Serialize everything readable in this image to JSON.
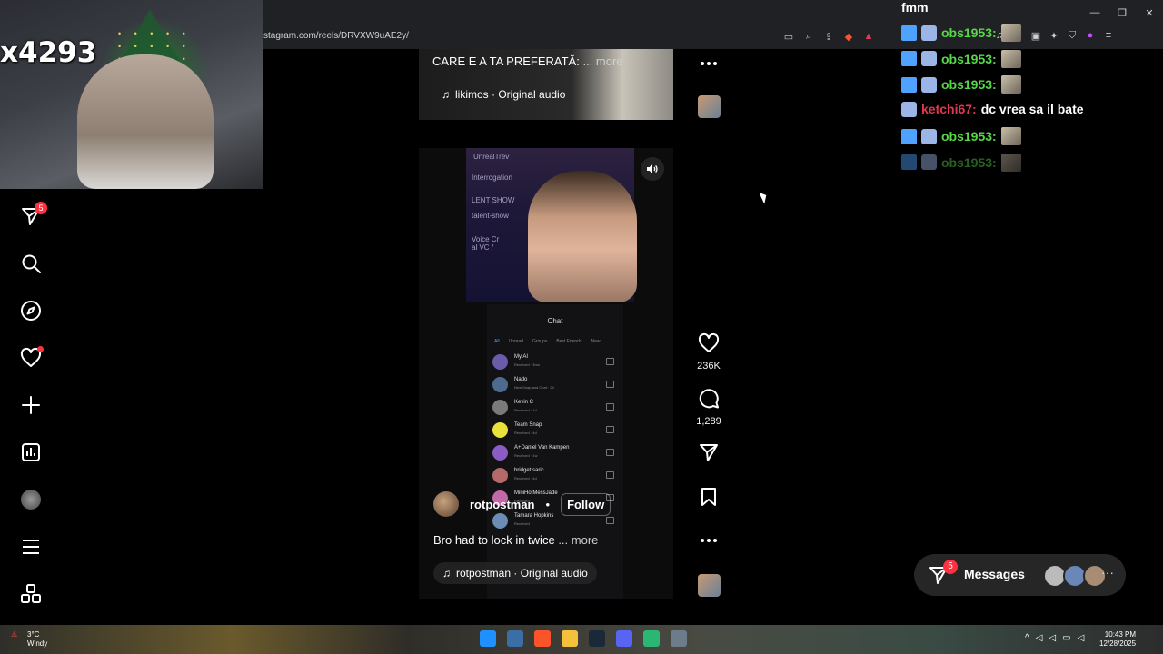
{
  "browser": {
    "url": "stagram.com/reels/DRVXW9uAE2y/"
  },
  "webcam": {
    "overlay_text": "x4293"
  },
  "nav": {
    "notifications_badge": "5"
  },
  "prev_reel": {
    "caption": "CARE E A TA PREFERATĂ:",
    "more": "... more",
    "audio": "likimos · Original audio"
  },
  "reel": {
    "stream_user": "UnrealTrev",
    "stream_lines": [
      "Interrogation",
      "LENT SHOW",
      "talent-show",
      "Voice Cr",
      "al VC /"
    ],
    "phone_header": "Chat",
    "phone_filters": [
      "All",
      "Unread",
      "Groups",
      "Best Friends",
      "New"
    ],
    "phone_chats": [
      {
        "name": "My AI",
        "sub": "Received · 3mo",
        "color": "#6b5cab"
      },
      {
        "name": "Nado",
        "sub": "New Snap and Chat · 2h",
        "color": "#4e6b8f"
      },
      {
        "name": "Kevin C",
        "sub": "Received · 1d",
        "color": "#7a7a7a"
      },
      {
        "name": "Team Snap",
        "sub": "Received · 4d",
        "color": "#e8e23a"
      },
      {
        "name": "A+Daniel Van Kampen",
        "sub": "Received · 1w",
        "color": "#8b5cc4"
      },
      {
        "name": "bridget saric",
        "sub": "Received · 4d",
        "color": "#b56a6a"
      },
      {
        "name": "MiniHotMessJade",
        "sub": "Received",
        "color": "#c26aa8"
      },
      {
        "name": "Tamara Hopkins",
        "sub": "Received",
        "color": "#6a8cb5"
      }
    ],
    "username": "rotpostman",
    "separator": "•",
    "follow": "Follow",
    "caption": "Bro had to lock in twice",
    "more": "... more",
    "audio": "rotpostman · Original audio"
  },
  "actions": {
    "likes": "236K",
    "comments": "1,289"
  },
  "chat": {
    "title": "fmm",
    "lines": [
      {
        "user": "obs1953:",
        "user_color": "#56d846",
        "text": "",
        "top": 0
      },
      {
        "user": "obs1953:",
        "user_color": "#56d846",
        "text": ""
      },
      {
        "user": "obs1953:",
        "user_color": "#56d846",
        "text": ""
      },
      {
        "user": "ketchi67:",
        "user_color": "#e0374f",
        "text": "dc vrea sa il bate"
      },
      {
        "user": "obs1953:",
        "user_color": "#56d846",
        "text": ""
      },
      {
        "user": "obs1953:",
        "user_color": "#56d846",
        "text": ""
      }
    ]
  },
  "messages": {
    "badge": "5",
    "label": "Messages"
  },
  "taskbar": {
    "temp": "3°C",
    "condition": "Windy",
    "time": "10:43 PM",
    "date": "12/28/2025"
  }
}
